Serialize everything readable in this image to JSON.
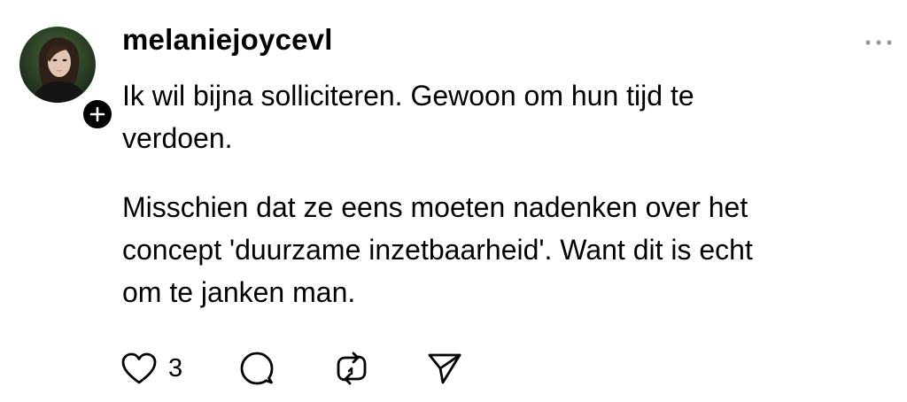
{
  "post": {
    "username": "melaniejoycevl",
    "paragraphs": [
      [
        "Ik wil bijna solliciteren. Gewoon om hun tijd te",
        "verdoen."
      ],
      [
        "Misschien dat ze eens moeten nadenken over het",
        "concept 'duurzame inzetbaarheid'. Want dit is echt",
        "om te janken man."
      ]
    ],
    "icons": {
      "more": "more-horizontal-icon",
      "follow": "plus-icon",
      "like": "heart-icon",
      "reply": "comment-icon",
      "repost": "repost-icon",
      "share": "send-icon"
    },
    "stats": {
      "likes": "3"
    }
  },
  "colors": {
    "text": "#000000",
    "muted": "#9a9a9a",
    "background": "#ffffff"
  }
}
